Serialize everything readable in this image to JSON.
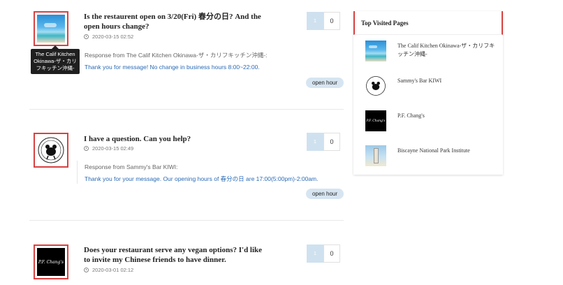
{
  "questions": [
    {
      "thumb_tooltip": "The Calif Kitchen Okinawa-ザ・カリフキッチン沖縄-",
      "title": "Is the restaurent open on 3/20(Fri) 春分の日? And the open hours change?",
      "date": "2020-03-15 02:52",
      "vote_up": "1",
      "vote_count": "0",
      "response_label": "Response from The Calif Kitchen Okinawa-ザ・カリフキッチン沖縄-:",
      "response_text": "Thank you for message! No change in business hours 8:00~22:00.",
      "tag": "open hour"
    },
    {
      "title": "I have a question. Can you help?",
      "date": "2020-03-15 02:49",
      "vote_up": "1",
      "vote_count": "0",
      "response_label": "Response from Sammy's Bar KIWI:",
      "response_text": "Thank you for your message. Our opening hours of 春分の日 are 17:00(5:00pm)-2:00am.",
      "tag": "open hour"
    },
    {
      "title": "Does your restaurant serve any vegan options? I'd like to invite my Chinese friends to have dinner.",
      "date": "2020-03-01 02:12",
      "vote_up": "1",
      "vote_count": "0",
      "logo_text": "P.F. Chang's"
    }
  ],
  "sidebar": {
    "title": "Top Visited Pages",
    "items": [
      {
        "label": "The Calif Kitchen Okinawa-ザ・カリフキッチン沖縄-"
      },
      {
        "label": "Sammy's Bar KIWI"
      },
      {
        "label": "P.F. Chang's",
        "logo_text": "P.F. Chang's"
      },
      {
        "label": "Biscayne National Park Institute"
      }
    ]
  },
  "colors": {
    "accent_red": "#d94141",
    "link_blue": "#2a6bb6",
    "vote_blue": "#cfe1ef",
    "tag_bg": "#d6e5f1"
  }
}
